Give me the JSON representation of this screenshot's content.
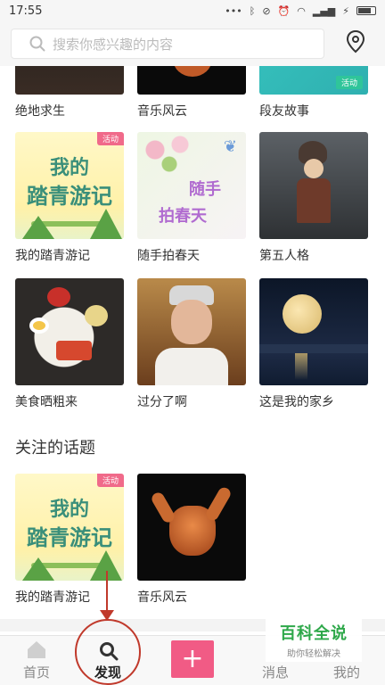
{
  "status_bar": {
    "time": "17:55"
  },
  "search": {
    "placeholder": "搜索你感兴趣的内容"
  },
  "grid_rows": [
    {
      "items": [
        {
          "label": "绝地求生"
        },
        {
          "label": "音乐风云"
        },
        {
          "label": "段友故事",
          "badge": "活动"
        }
      ]
    },
    {
      "items": [
        {
          "label": "我的踏青游记",
          "badge": "活动",
          "art_title_1": "我的",
          "art_title_2": "踏青游记"
        },
        {
          "label": "随手拍春天",
          "art_title_1": "随手",
          "art_title_2": "拍春天"
        },
        {
          "label": "第五人格"
        }
      ]
    },
    {
      "items": [
        {
          "label": "美食晒粗来"
        },
        {
          "label": "过分了啊"
        },
        {
          "label": "这是我的家乡"
        }
      ]
    }
  ],
  "followed_section": {
    "title": "关注的话题",
    "items": [
      {
        "label": "我的踏青游记",
        "badge": "活动",
        "art_title_1": "我的",
        "art_title_2": "踏青游记"
      },
      {
        "label": "音乐风云"
      }
    ]
  },
  "bottom_nav": {
    "items": [
      {
        "label": "首页"
      },
      {
        "label": "发现"
      },
      {
        "label": "消息"
      },
      {
        "label": "我的"
      }
    ],
    "active": "发现"
  },
  "watermark": {
    "title": "百科全说",
    "subtitle": "助你轻松解决"
  },
  "colors": {
    "accent": "#f15b85",
    "badge": "#f06a8a",
    "highlight": "#c0392b",
    "watermark": "#2ea84a"
  }
}
